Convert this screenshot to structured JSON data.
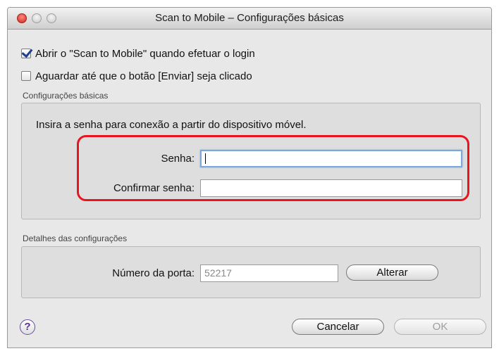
{
  "window": {
    "title": "Scan to Mobile – Configurações básicas"
  },
  "options": {
    "open_on_login": {
      "label": "Abrir o \"Scan to Mobile\" quando efetuar o login",
      "checked": true
    },
    "wait_send": {
      "label": "Aguardar até que o botão [Enviar] seja clicado",
      "checked": false
    }
  },
  "basic_settings": {
    "group_title": "Configurações básicas",
    "instruction": "Insira a senha para conexão a partir do dispositivo móvel.",
    "password_label": "Senha:",
    "password_value": "",
    "confirm_label": "Confirmar senha:",
    "confirm_value": ""
  },
  "details": {
    "group_title": "Detalhes das configurações",
    "port_label": "Número da porta:",
    "port_value": "52217",
    "change_button": "Alterar"
  },
  "footer": {
    "help_icon": "?",
    "cancel_button": "Cancelar",
    "ok_button": "OK"
  },
  "colors": {
    "highlight": "#e8141e",
    "focus_ring": "#7ea7dc",
    "close_button": "#d0261b"
  }
}
